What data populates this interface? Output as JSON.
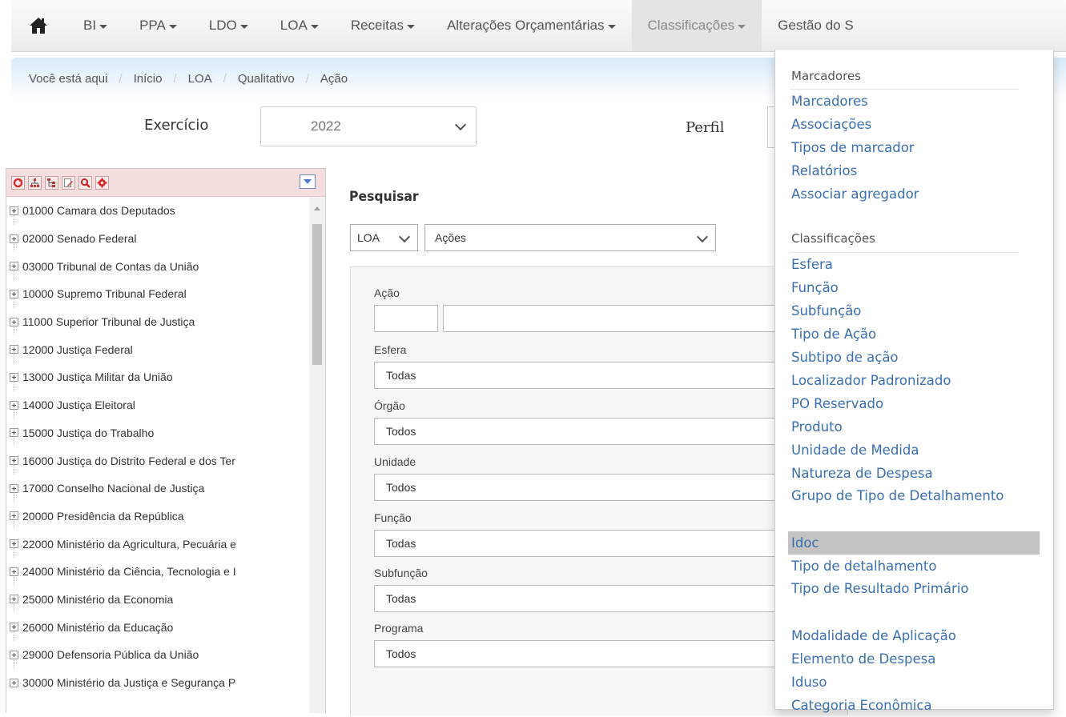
{
  "navbar": {
    "items": [
      {
        "label": "BI"
      },
      {
        "label": "PPA"
      },
      {
        "label": "LDO"
      },
      {
        "label": "LOA"
      },
      {
        "label": "Receitas"
      },
      {
        "label": "Alterações Orçamentárias"
      },
      {
        "label": "Classificações"
      },
      {
        "label": "Gestão do S"
      }
    ]
  },
  "breadcrumb": {
    "prefix": "Você está aqui",
    "items": [
      "Início",
      "LOA",
      "Qualitativo",
      "Ação"
    ]
  },
  "filters": {
    "exercicio_label": "Exercício",
    "exercicio_value": "2022",
    "perfil_label": "Perfil"
  },
  "tree": {
    "items": [
      "01000 Camara dos Deputados",
      "02000 Senado Federal",
      "03000 Tribunal de Contas da União",
      "10000 Supremo Tribunal Federal",
      "11000 Superior Tribunal de Justiça",
      "12000 Justiça Federal",
      "13000 Justiça Militar da União",
      "14000 Justiça Eleitoral",
      "15000 Justiça do Trabalho",
      "16000 Justiça do Distrito Federal e dos Ter",
      "17000 Conselho Nacional de Justiça",
      "20000 Presidência da República",
      "22000 Ministério da Agricultura, Pecuária e",
      "24000 Ministério da Ciência, Tecnologia e I",
      "25000 Ministério da Economia",
      "26000 Ministério da Educação",
      "29000 Defensoria Pública da União",
      "30000 Ministério da Justiça e Segurança P"
    ]
  },
  "search": {
    "title": "Pesquisar",
    "source_value": "LOA",
    "type_value": "Ações",
    "fields": {
      "acao_label": "Ação",
      "esfera_label": "Esfera",
      "esfera_value": "Todas",
      "orgao_label": "Órgão",
      "orgao_value": "Todos",
      "unidade_label": "Unidade",
      "unidade_value": "Todos",
      "funcao_label": "Função",
      "funcao_value": "Todas",
      "subfuncao_label": "Subfunção",
      "subfuncao_value": "Todas",
      "programa_label": "Programa",
      "programa_value": "Todos"
    }
  },
  "dropdown": {
    "marcadores_header": "Marcadores",
    "marcadores_items": [
      "Marcadores",
      "Associações",
      "Tipos de marcador",
      "Relatórios",
      "Associar agregador"
    ],
    "classificacoes_header": "Classificações",
    "classificacoes_items": [
      "Esfera",
      "Função",
      "Subfunção",
      "Tipo de Ação",
      "Subtipo de ação",
      "Localizador Padronizado",
      "PO Reservado",
      "Produto",
      "Unidade de Medida",
      "Natureza de Despesa",
      "Grupo de Tipo de Detalhamento",
      "Idoc",
      "Tipo de detalhamento",
      "Tipo de Resultado Primário",
      "Modalidade de Aplicação",
      "Elemento de Despesa",
      "Iduso",
      "Categoria Econômica"
    ],
    "highlighted_item": "Idoc"
  }
}
